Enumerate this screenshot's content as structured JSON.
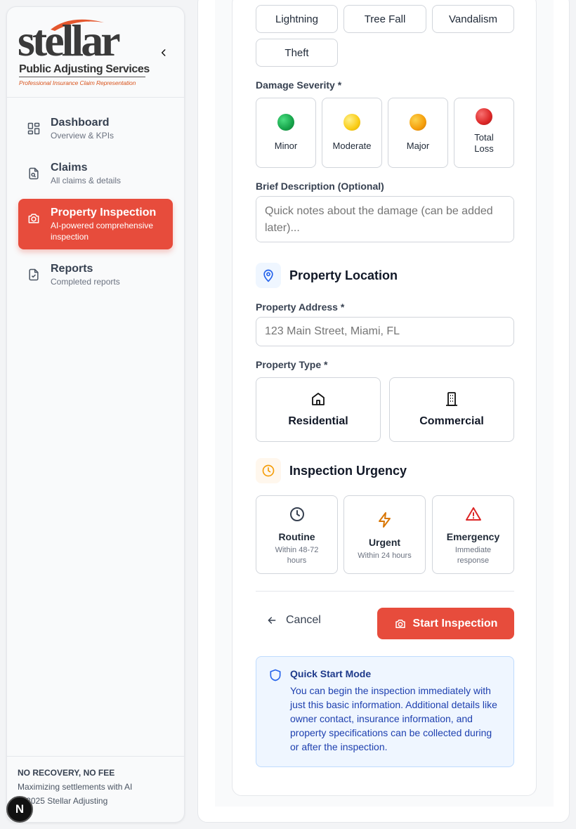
{
  "brand": {
    "word": "stellar",
    "subtitle": "Public Adjusting Services",
    "tagline": "Professional Insurance Claim Representation"
  },
  "nav": [
    {
      "title": "Dashboard",
      "sub": "Overview & KPIs"
    },
    {
      "title": "Claims",
      "sub": "All claims & details"
    },
    {
      "title": "Property Inspection",
      "sub": "AI-powered comprehensive inspection"
    },
    {
      "title": "Reports",
      "sub": "Completed reports"
    }
  ],
  "footer": {
    "line1": "NO RECOVERY, NO FEE",
    "line2": "Maximizing settlements with AI",
    "line3": "© 2025 Stellar Adjusting",
    "badge": "N"
  },
  "damage_types": [
    "Lightning",
    "Tree Fall",
    "Vandalism",
    "Theft"
  ],
  "severity": {
    "label": "Damage Severity *",
    "options": [
      {
        "name": "Minor",
        "color": "#16a34a"
      },
      {
        "name": "Moderate",
        "color": "#facc15"
      },
      {
        "name": "Major",
        "color": "#f59e0b"
      },
      {
        "name": "Total Loss",
        "color": "#dc2626"
      }
    ]
  },
  "description": {
    "label": "Brief Description (Optional)",
    "placeholder": "Quick notes about the damage (can be added later)..."
  },
  "location": {
    "title": "Property Location",
    "address_label": "Property Address *",
    "address_placeholder": "123 Main Street, Miami, FL",
    "type_label": "Property Type *",
    "types": [
      "Residential",
      "Commercial"
    ]
  },
  "urgency": {
    "title": "Inspection Urgency",
    "options": [
      {
        "title": "Routine",
        "sub": "Within 48-72 hours"
      },
      {
        "title": "Urgent",
        "sub": "Within 24 hours"
      },
      {
        "title": "Emergency",
        "sub": "Immediate response"
      }
    ]
  },
  "actions": {
    "cancel": "Cancel",
    "start": "Start Inspection"
  },
  "info": {
    "title": "Quick Start Mode",
    "body": "You can begin the inspection immediately with just this basic information. Additional details like owner contact, insurance information, and property specifications can be collected during or after the inspection."
  },
  "colors": {
    "accent": "#e74c3c",
    "info_bg": "#eff6ff"
  }
}
